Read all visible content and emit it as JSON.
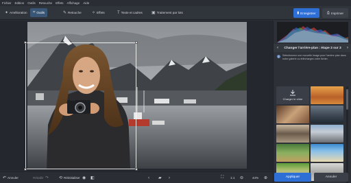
{
  "menu": [
    "Fichier",
    "Edition",
    "Outils",
    "Retouche",
    "Effets",
    "Affichage",
    "Aide"
  ],
  "toolbar": {
    "tools": [
      {
        "label": "Amélioration",
        "icon": "enhance-icon"
      },
      {
        "label": "Outils",
        "icon": "crop-icon"
      },
      {
        "label": "Retouche",
        "icon": "brush-icon"
      },
      {
        "label": "Effets",
        "icon": "effects-icon"
      },
      {
        "label": "Texte et cadres",
        "icon": "text-icon"
      },
      {
        "label": "Traitement par lots",
        "icon": "batch-icon"
      }
    ],
    "save_label": "Enregistrer",
    "print_label": "Imprimer"
  },
  "bottombar": {
    "undo_label": "Annuler",
    "redo_label": "Rétablir",
    "reset_label": "Réinitialiser",
    "zoom_ratio": "1:1",
    "zoom_level": "44%"
  },
  "panel": {
    "step_title": "Changer l'arrière-plan : étape 3 sur 3",
    "info_text": "Sélectionnez une nouvelle image pour l'arrière plan dans notre galerie ou téléchargez votre fichier.",
    "upload_label": "Charger le vôtre"
  },
  "actions": {
    "apply_label": "Appliquer",
    "cancel_label": "Annuler"
  },
  "colors": {
    "accent": "#2e6fd6",
    "active_tool": "#3a5676"
  }
}
